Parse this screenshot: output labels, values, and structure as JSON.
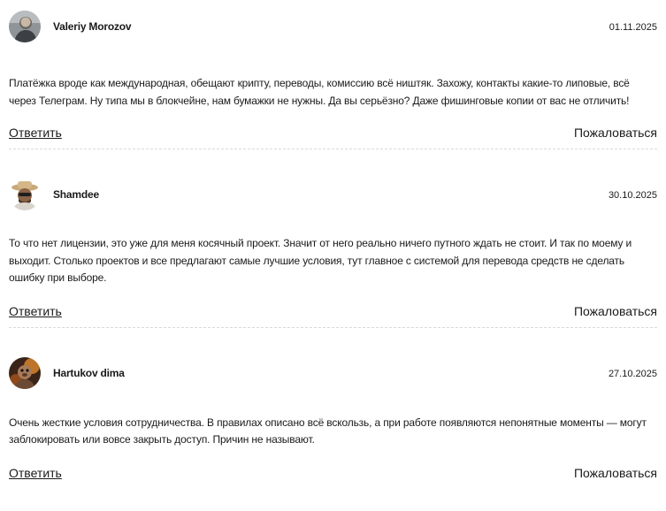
{
  "comments": [
    {
      "author": "Valeriy Morozov",
      "date": "01.11.2025",
      "text": "Платёжка вроде как международная, обещают крипту, переводы, комиссию всё ништяк. Захожу, контакты какие-то липовые, всё через Телеграм. Ну типа мы в блокчейне, нам бумажки не нужны. Да вы серьёзно? Даже фишинговые копии от вас не отличить!",
      "reply_label": "Ответить",
      "report_label": "Пожаловаться",
      "avatar_icon": "user-photo-icon"
    },
    {
      "author": "Shamdee",
      "date": "30.10.2025",
      "text": "То что нет лицензии, это уже для меня косячный проект. Значит от него реально ничего путного ждать не стоит. И так по моему и выходит. Столько проектов и все предлагают самые лучшие условия, тут главное с системой для перевода средств не сделать ошибку при выборе.",
      "reply_label": "Ответить",
      "report_label": "Пожаловаться",
      "avatar_icon": "user-photo-icon"
    },
    {
      "author": "Hartukov dima",
      "date": "27.10.2025",
      "text": "Очень жесткие условия сотрудничества. В правилах описано всё вскользь, а при работе появляются непонятные моменты — могут заблокировать или вовсе закрыть доступ. Причин не называют.",
      "reply_label": "Ответить",
      "report_label": "Пожаловаться",
      "avatar_icon": "user-photo-icon"
    }
  ]
}
